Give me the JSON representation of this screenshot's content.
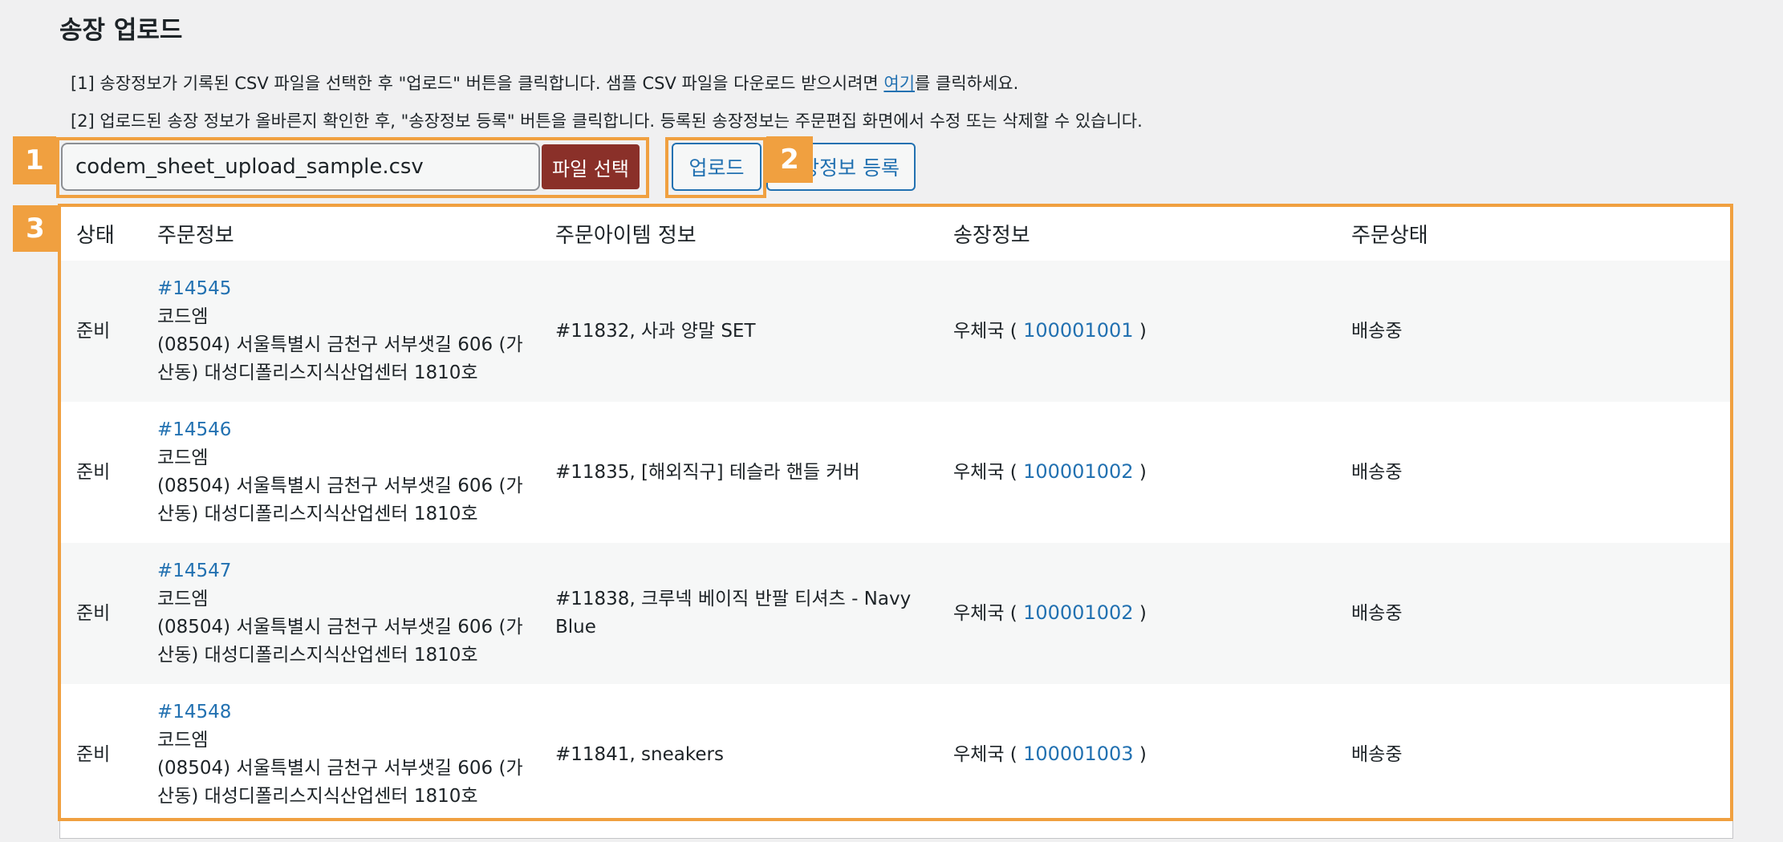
{
  "title": "송장 업로드",
  "instructions": {
    "line1_before": "[1] 송장정보가 기록된 CSV 파일을 선택한 후 \"업로드\" 버튼을 클릭합니다. 샘플 CSV 파일을 다운로드 받으시려면 ",
    "line1_link": "여기",
    "line1_after": "를 클릭하세요.",
    "line2": "[2] 업로드된 송장 정보가 올바른지 확인한 후, \"송장정보 등록\" 버튼을 클릭합니다. 등록된 송장정보는 주문편집 화면에서 수정 또는 삭제할 수 있습니다."
  },
  "file": {
    "value": "codem_sheet_upload_sample.csv",
    "choose_label": "파일 선택"
  },
  "buttons": {
    "upload": "업로드",
    "register": "송장정보 등록"
  },
  "badges": [
    "1",
    "2",
    "3"
  ],
  "table": {
    "headers": [
      "상태",
      "주문정보",
      "주문아이템 정보",
      "송장정보",
      "주문상태"
    ],
    "rows": [
      {
        "status": "준비",
        "order_no": "#14545",
        "name": "코드엠",
        "address1": "(08504) 서울특별시 금천구 서부샛길 606 (가",
        "address2": "산동) 대성디폴리스지식산업센터 1810호",
        "item1": "#11832, 사과 양말 SET",
        "item2": "",
        "carrier": "우체국 ( ",
        "tracking": "100001001",
        "carrier_close": " )",
        "order_status": "배송중"
      },
      {
        "status": "준비",
        "order_no": "#14546",
        "name": "코드엠",
        "address1": "(08504) 서울특별시 금천구 서부샛길 606 (가",
        "address2": "산동) 대성디폴리스지식산업센터 1810호",
        "item1": "#11835, [해외직구] 테슬라 핸들 커버",
        "item2": "",
        "carrier": "우체국 ( ",
        "tracking": "100001002",
        "carrier_close": " )",
        "order_status": "배송중"
      },
      {
        "status": "준비",
        "order_no": "#14547",
        "name": "코드엠",
        "address1": "(08504) 서울특별시 금천구 서부샛길 606 (가",
        "address2": "산동) 대성디폴리스지식산업센터 1810호",
        "item1": "#11838, 크루넥 베이직 반팔 티셔츠 - Navy",
        "item2": "Blue",
        "carrier": "우체국 ( ",
        "tracking": "100001002",
        "carrier_close": " )",
        "order_status": "배송중"
      },
      {
        "status": "준비",
        "order_no": "#14548",
        "name": "코드엠",
        "address1": "(08504) 서울특별시 금천구 서부샛길 606 (가",
        "address2": "산동) 대성디폴리스지식산업센터 1810호",
        "item1": "#11841, sneakers",
        "item2": "",
        "carrier": "우체국 ( ",
        "tracking": "100001003",
        "carrier_close": " )",
        "order_status": "배송중"
      }
    ]
  },
  "colors": {
    "highlight": "#f0a040",
    "link": "#2271b1",
    "file_button": "#8a3029",
    "background": "#f0f0f1"
  }
}
